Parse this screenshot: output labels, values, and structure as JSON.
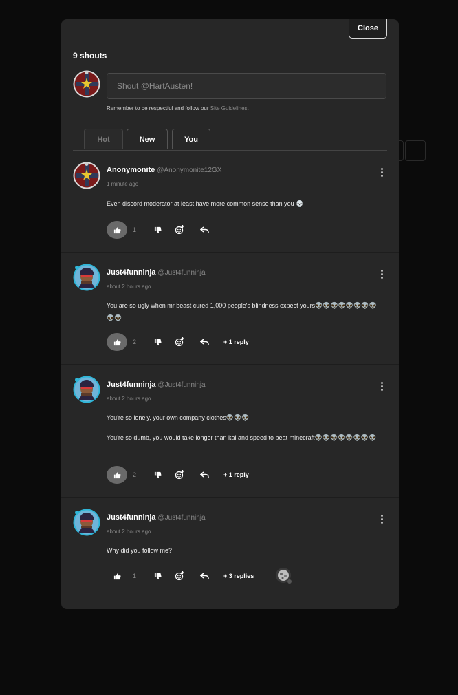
{
  "modal": {
    "close_label": "Close",
    "shout_count": "9 shouts",
    "input_placeholder": "Shout @HartAusten!",
    "guidelines_text": "Remember to be respectful and follow our ",
    "guidelines_link": "Site Guidelines",
    "guidelines_end": "."
  },
  "tabs": [
    {
      "label": "Hot",
      "active": true
    },
    {
      "label": "New",
      "active": false
    },
    {
      "label": "You",
      "active": false
    }
  ],
  "comments": [
    {
      "name": "Anonymonite",
      "handle": "@Anonymonite12GX",
      "time": "1 minute ago",
      "paragraphs": [
        "Even discord moderator at least have more common sense than you 💀"
      ],
      "likes": "1",
      "replies": ""
    },
    {
      "name": "Just4funninja",
      "handle": "@Just4funninja",
      "time": "about 2 hours ago",
      "paragraphs": [
        "You are so ugly when mr beast cured 1,000 people's blindness expect yours👽👽👽👽👽👽👽👽👽👽"
      ],
      "likes": "2",
      "replies": "+ 1 reply"
    },
    {
      "name": "Just4funninja",
      "handle": "@Just4funninja",
      "time": "about 2 hours ago",
      "paragraphs": [
        "You're so lonely, your own company clothes👽👽👽",
        "You're so dumb, you would take longer than kai and speed to beat minecraft👽👽👽👽👽👽👽👽"
      ],
      "likes": "2",
      "replies": "+ 1 reply"
    },
    {
      "name": "Just4funninja",
      "handle": "@Just4funninja",
      "time": "about 2 hours ago",
      "paragraphs": [
        "Why did you follow me?"
      ],
      "likes": "1",
      "replies": "+ 3 replies"
    }
  ],
  "icons": {
    "like": "thumbs-up-icon",
    "dislike": "thumbs-down-icon",
    "react": "add-reaction-icon",
    "reply": "reply-arrow-icon",
    "more": "more-vertical-icon"
  },
  "colors": {
    "modal_bg": "#272727",
    "page_bg": "#0b0b0b",
    "avatar_ring": "#2fb6d8"
  }
}
